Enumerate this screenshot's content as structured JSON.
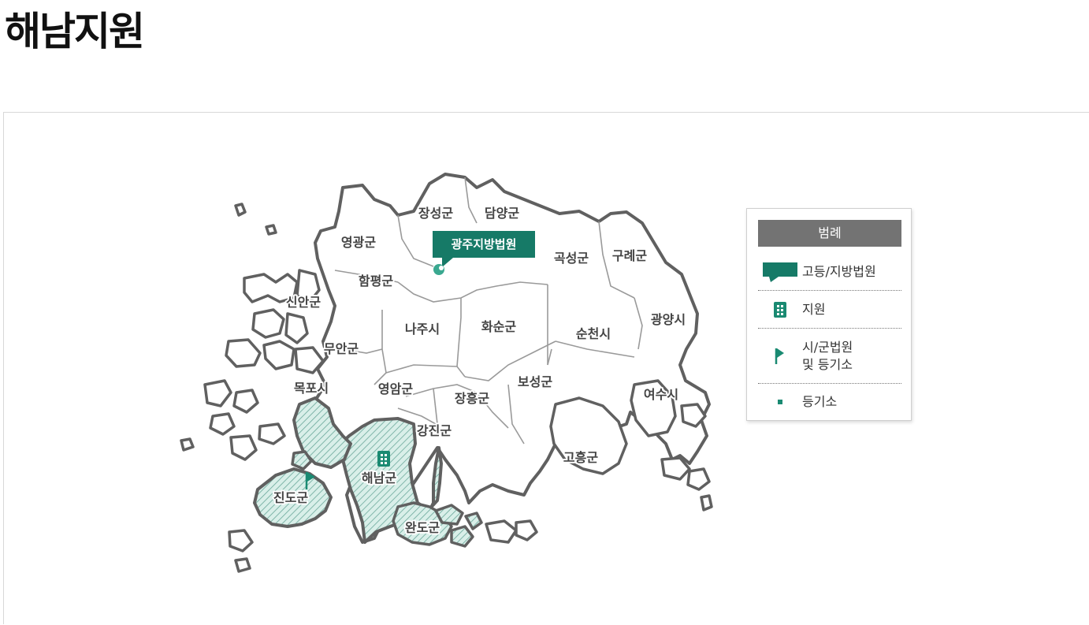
{
  "page": {
    "title": "해남지원"
  },
  "map": {
    "court_callout": "광주지방법원",
    "regions": [
      "장성군",
      "담양군",
      "영광군",
      "곡성군",
      "구례군",
      "함평군",
      "신안군",
      "나주시",
      "화순군",
      "순천시",
      "광양시",
      "무안군",
      "목포시",
      "영암군",
      "장흥군",
      "보성군",
      "여수시",
      "강진군",
      "해남군",
      "고흥군",
      "진도군",
      "완도군"
    ],
    "highlighted_regions": [
      "해남군",
      "진도군",
      "완도군"
    ],
    "colors": {
      "court_green": "#167a67",
      "highlight_fill": "#d9efe9",
      "hatch": "#6aa89a",
      "border": "#606060",
      "inner_border": "#9a9a9a"
    }
  },
  "legend": {
    "title": "범례",
    "items": [
      {
        "icon": "court-callout-icon",
        "label": "고등/지방법원"
      },
      {
        "icon": "branch-building-icon",
        "label": "지원"
      },
      {
        "icon": "flag-icon",
        "label_line1": "시/군법원",
        "label_line2": "및 등기소"
      },
      {
        "icon": "square-dot-icon",
        "label": "등기소"
      }
    ]
  }
}
